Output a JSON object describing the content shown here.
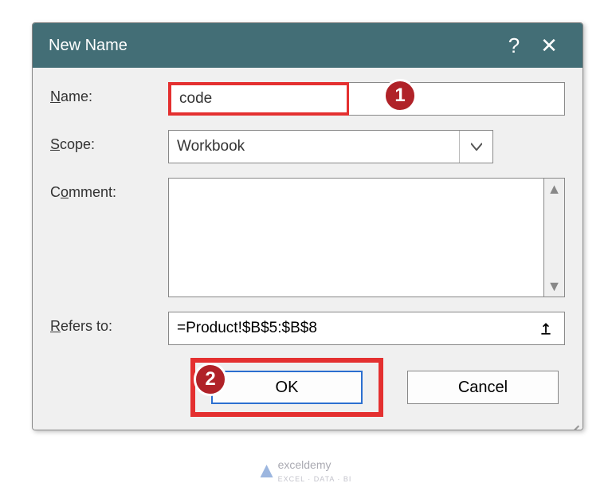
{
  "dialog": {
    "title": "New Name",
    "labels": {
      "name": "Name:",
      "scope": "Scope:",
      "comment": "Comment:",
      "refers": "Refers to:"
    },
    "fields": {
      "name_value": "code",
      "scope_value": "Workbook",
      "comment_value": "",
      "refers_value": "=Product!$B$5:$B$8"
    },
    "buttons": {
      "ok": "OK",
      "cancel": "Cancel"
    }
  },
  "callouts": {
    "one": "1",
    "two": "2"
  },
  "watermark": {
    "brand": "exceldemy",
    "tagline": "EXCEL · DATA · BI"
  }
}
